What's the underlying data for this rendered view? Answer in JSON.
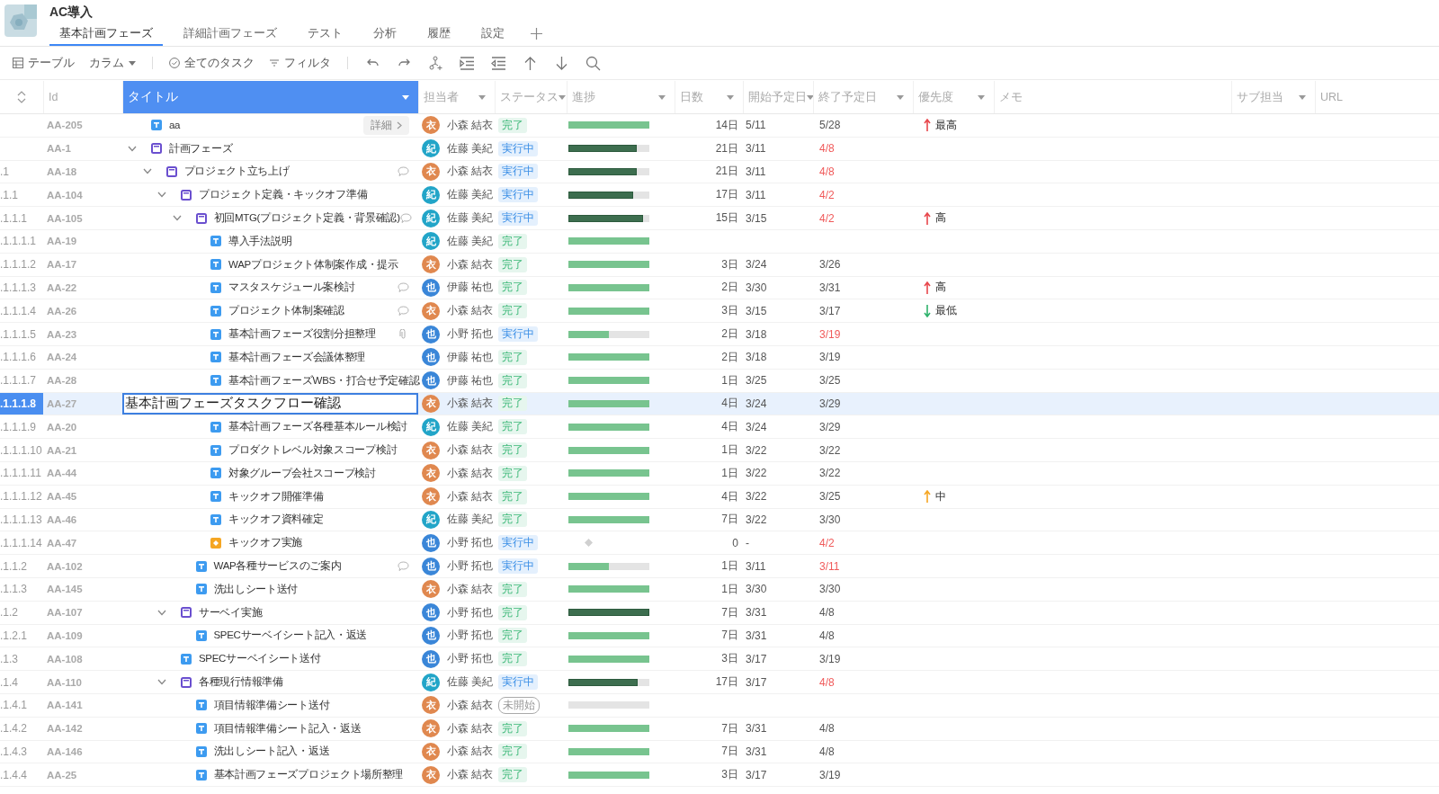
{
  "project": {
    "name": "AC導入"
  },
  "tabs": [
    {
      "label": "基本計画フェーズ",
      "selected": true
    },
    {
      "label": "詳細計画フェーズ",
      "selected": false
    },
    {
      "label": "テスト",
      "selected": false
    },
    {
      "label": "分析",
      "selected": false
    },
    {
      "label": "履歴",
      "selected": false
    },
    {
      "label": "設定",
      "selected": false
    }
  ],
  "toolbar": {
    "view": "テーブル",
    "columns": "カラム",
    "scope": "全てのタスク",
    "filter": "フィルタ"
  },
  "table": {
    "columns": [
      {
        "label": "Id",
        "menu": false,
        "selected": false
      },
      {
        "label": "タイトル",
        "menu": true,
        "selected": true
      },
      {
        "label": "担当者",
        "menu": true,
        "selected": false
      },
      {
        "label": "ステータス",
        "menu": true,
        "selected": false
      },
      {
        "label": "進捗",
        "menu": true,
        "selected": false
      },
      {
        "label": "日数",
        "menu": true,
        "selected": false
      },
      {
        "label": "開始予定日",
        "menu": true,
        "selected": false
      },
      {
        "label": "終了予定日",
        "menu": true,
        "selected": false
      },
      {
        "label": "優先度",
        "menu": true,
        "selected": false
      },
      {
        "label": "メモ",
        "menu": false,
        "selected": false
      },
      {
        "label": "サブ担当",
        "menu": true,
        "selected": false
      },
      {
        "label": "URL",
        "menu": false,
        "selected": false
      }
    ],
    "rows": [
      {
        "id": "AA-205",
        "title": "aa",
        "kind": "task",
        "detail_button": "詳細",
        "selected": false,
        "editing": false,
        "assignee": {
          "initial": "衣",
          "name": "小森 結衣",
          "color": "#e0884f"
        },
        "status": {
          "label": "完了",
          "kind": "done"
        },
        "progress": {
          "kind": "task",
          "level": 1
        },
        "days": "14日",
        "start": "5/11",
        "end": "5/28",
        "overdue": false,
        "priority": {
          "label": "最高",
          "kind": "up",
          "color": "#e8474c"
        }
      },
      {
        "id": "AA-1",
        "title": "計画フェーズ",
        "kind": "folder",
        "expanded": true,
        "selected": false,
        "editing": false,
        "assignee": {
          "initial": "紀",
          "name": "佐藤 美紀",
          "color": "#22a5c8"
        },
        "status": {
          "label": "実行中",
          "kind": "running"
        },
        "progress": {
          "kind": "summary",
          "level": 0.84
        },
        "days": "21日",
        "start": "3/11",
        "end": "4/8",
        "overdue": true,
        "children": [
          {
            "wbs": ".1",
            "id": "AA-18",
            "title": "プロジェクト立ち上げ",
            "kind": "folder",
            "expanded": true,
            "note": {
              "kind": "comment"
            },
            "selected": false,
            "editing": false,
            "assignee": {
              "initial": "衣",
              "name": "小森 結衣",
              "color": "#e0884f"
            },
            "status": {
              "label": "実行中",
              "kind": "running"
            },
            "progress": {
              "kind": "summary",
              "level": 0.84
            },
            "days": "21日",
            "start": "3/11",
            "end": "4/8",
            "overdue": true,
            "children": [
              {
                "wbs": ".1.1",
                "id": "AA-104",
                "title": "プロジェクト定義・キックオフ準備",
                "kind": "folder",
                "expanded": true,
                "selected": false,
                "editing": false,
                "assignee": {
                  "initial": "紀",
                  "name": "佐藤 美紀",
                  "color": "#22a5c8"
                },
                "status": {
                  "label": "実行中",
                  "kind": "running"
                },
                "progress": {
                  "kind": "summary",
                  "level": 0.8
                },
                "days": "17日",
                "start": "3/11",
                "end": "4/2",
                "overdue": true,
                "children": [
                  {
                    "wbs": ".1.1.1",
                    "id": "AA-105",
                    "title": "初回MTG(プロジェクト定義・背景確認)",
                    "kind": "folder",
                    "expanded": true,
                    "note": {
                      "kind": "comment"
                    },
                    "selected": false,
                    "editing": false,
                    "assignee": {
                      "initial": "紀",
                      "name": "佐藤 美紀",
                      "color": "#22a5c8"
                    },
                    "status": {
                      "label": "実行中",
                      "kind": "running"
                    },
                    "progress": {
                      "kind": "summary",
                      "level": 0.92
                    },
                    "days": "15日",
                    "start": "3/15",
                    "end": "4/2",
                    "overdue": true,
                    "priority": {
                      "label": "高",
                      "kind": "up",
                      "color": "#e8474c"
                    },
                    "children": [
                      {
                        "wbs": ".1.1.1.1",
                        "id": "AA-19",
                        "title": "導入手法説明",
                        "kind": "task",
                        "selected": false,
                        "editing": false,
                        "assignee": {
                          "initial": "紀",
                          "name": "佐藤 美紀",
                          "color": "#22a5c8"
                        },
                        "status": {
                          "label": "完了",
                          "kind": "done"
                        },
                        "progress": {
                          "kind": "task",
                          "level": 1
                        },
                        "overdue": false
                      },
                      {
                        "wbs": ".1.1.1.2",
                        "id": "AA-17",
                        "title": "WAPプロジェクト体制案作成・提示",
                        "kind": "task",
                        "selected": false,
                        "editing": false,
                        "assignee": {
                          "initial": "衣",
                          "name": "小森 結衣",
                          "color": "#e0884f"
                        },
                        "status": {
                          "label": "完了",
                          "kind": "done"
                        },
                        "progress": {
                          "kind": "task",
                          "level": 1
                        },
                        "days": "3日",
                        "start": "3/24",
                        "end": "3/26",
                        "overdue": false
                      },
                      {
                        "wbs": ".1.1.1.3",
                        "id": "AA-22",
                        "title": "マスタスケジュール案検討",
                        "kind": "task",
                        "note": {
                          "kind": "comment"
                        },
                        "selected": false,
                        "editing": false,
                        "assignee": {
                          "initial": "也",
                          "name": "伊藤 祐也",
                          "color": "#3a86d8"
                        },
                        "status": {
                          "label": "完了",
                          "kind": "done"
                        },
                        "progress": {
                          "kind": "task",
                          "level": 1
                        },
                        "days": "2日",
                        "start": "3/30",
                        "end": "3/31",
                        "overdue": false,
                        "priority": {
                          "label": "高",
                          "kind": "up",
                          "color": "#e8474c"
                        }
                      },
                      {
                        "wbs": ".1.1.1.4",
                        "id": "AA-26",
                        "title": "プロジェクト体制案確認",
                        "kind": "task",
                        "note": {
                          "kind": "comment"
                        },
                        "selected": false,
                        "editing": false,
                        "assignee": {
                          "initial": "衣",
                          "name": "小森 結衣",
                          "color": "#e0884f"
                        },
                        "status": {
                          "label": "完了",
                          "kind": "done"
                        },
                        "progress": {
                          "kind": "task",
                          "level": 1
                        },
                        "days": "3日",
                        "start": "3/15",
                        "end": "3/17",
                        "overdue": false,
                        "priority": {
                          "label": "最低",
                          "kind": "down",
                          "color": "#2fb26c"
                        }
                      },
                      {
                        "wbs": ".1.1.1.5",
                        "id": "AA-23",
                        "title": "基本計画フェーズ役割分担整理",
                        "kind": "task",
                        "note": {
                          "kind": "attachment"
                        },
                        "selected": false,
                        "editing": false,
                        "assignee": {
                          "initial": "也",
                          "name": "小野 拓也",
                          "color": "#3a86d8"
                        },
                        "status": {
                          "label": "実行中",
                          "kind": "running"
                        },
                        "progress": {
                          "kind": "task",
                          "level": 0.5
                        },
                        "days": "2日",
                        "start": "3/18",
                        "end": "3/19",
                        "overdue": true
                      },
                      {
                        "wbs": ".1.1.1.6",
                        "id": "AA-24",
                        "title": "基本計画フェーズ会議体整理",
                        "kind": "task",
                        "selected": false,
                        "editing": false,
                        "assignee": {
                          "initial": "也",
                          "name": "伊藤 祐也",
                          "color": "#3a86d8"
                        },
                        "status": {
                          "label": "完了",
                          "kind": "done"
                        },
                        "progress": {
                          "kind": "task",
                          "level": 1
                        },
                        "days": "2日",
                        "start": "3/18",
                        "end": "3/19",
                        "overdue": false
                      },
                      {
                        "wbs": ".1.1.1.7",
                        "id": "AA-28",
                        "title": "基本計画フェーズWBS・打合せ予定確認",
                        "kind": "task",
                        "selected": false,
                        "editing": false,
                        "assignee": {
                          "initial": "也",
                          "name": "伊藤 祐也",
                          "color": "#3a86d8"
                        },
                        "status": {
                          "label": "完了",
                          "kind": "done"
                        },
                        "progress": {
                          "kind": "task",
                          "level": 1
                        },
                        "days": "1日",
                        "start": "3/25",
                        "end": "3/25",
                        "overdue": false
                      },
                      {
                        "wbs": ".1.1.1.8",
                        "id": "AA-27",
                        "title": "基本計画フェーズタスクフロー確認",
                        "kind": "task",
                        "selected": true,
                        "editing": true,
                        "assignee": {
                          "initial": "衣",
                          "name": "小森 結衣",
                          "color": "#e0884f"
                        },
                        "status": {
                          "label": "完了",
                          "kind": "done"
                        },
                        "progress": {
                          "kind": "task",
                          "level": 1
                        },
                        "days": "4日",
                        "start": "3/24",
                        "end": "3/29",
                        "overdue": false
                      },
                      {
                        "wbs": ".1.1.1.9",
                        "id": "AA-20",
                        "title": "基本計画フェーズ各種基本ルール検討",
                        "kind": "task",
                        "selected": false,
                        "editing": false,
                        "assignee": {
                          "initial": "紀",
                          "name": "佐藤 美紀",
                          "color": "#22a5c8"
                        },
                        "status": {
                          "label": "完了",
                          "kind": "done"
                        },
                        "progress": {
                          "kind": "task",
                          "level": 1
                        },
                        "days": "4日",
                        "start": "3/24",
                        "end": "3/29",
                        "overdue": false
                      },
                      {
                        "wbs": ".1.1.1.10",
                        "id": "AA-21",
                        "title": "プロダクトレベル対象スコープ検討",
                        "kind": "task",
                        "selected": false,
                        "editing": false,
                        "assignee": {
                          "initial": "衣",
                          "name": "小森 結衣",
                          "color": "#e0884f"
                        },
                        "status": {
                          "label": "完了",
                          "kind": "done"
                        },
                        "progress": {
                          "kind": "task",
                          "level": 1
                        },
                        "days": "1日",
                        "start": "3/22",
                        "end": "3/22",
                        "overdue": false
                      },
                      {
                        "wbs": ".1.1.1.11",
                        "id": "AA-44",
                        "title": "対象グループ会社スコープ検討",
                        "kind": "task",
                        "selected": false,
                        "editing": false,
                        "assignee": {
                          "initial": "衣",
                          "name": "小森 結衣",
                          "color": "#e0884f"
                        },
                        "status": {
                          "label": "完了",
                          "kind": "done"
                        },
                        "progress": {
                          "kind": "task",
                          "level": 1
                        },
                        "days": "1日",
                        "start": "3/22",
                        "end": "3/22",
                        "overdue": false
                      },
                      {
                        "wbs": ".1.1.1.12",
                        "id": "AA-45",
                        "title": "キックオフ開催準備",
                        "kind": "task",
                        "selected": false,
                        "editing": false,
                        "assignee": {
                          "initial": "衣",
                          "name": "小森 結衣",
                          "color": "#e0884f"
                        },
                        "status": {
                          "label": "完了",
                          "kind": "done"
                        },
                        "progress": {
                          "kind": "task",
                          "level": 1
                        },
                        "days": "4日",
                        "start": "3/22",
                        "end": "3/25",
                        "overdue": false,
                        "priority": {
                          "label": "中",
                          "kind": "up",
                          "color": "#f5a623"
                        }
                      },
                      {
                        "wbs": ".1.1.1.13",
                        "id": "AA-46",
                        "title": "キックオフ資料確定",
                        "kind": "task",
                        "selected": false,
                        "editing": false,
                        "assignee": {
                          "initial": "紀",
                          "name": "佐藤 美紀",
                          "color": "#22a5c8"
                        },
                        "status": {
                          "label": "完了",
                          "kind": "done"
                        },
                        "progress": {
                          "kind": "task",
                          "level": 1
                        },
                        "days": "7日",
                        "start": "3/22",
                        "end": "3/30",
                        "overdue": false
                      },
                      {
                        "wbs": ".1.1.1.14",
                        "id": "AA-47",
                        "title": "キックオフ実施",
                        "kind": "milestone",
                        "selected": false,
                        "editing": false,
                        "assignee": {
                          "initial": "也",
                          "name": "小野 拓也",
                          "color": "#3a86d8"
                        },
                        "status": {
                          "label": "実行中",
                          "kind": "running"
                        },
                        "progress": {
                          "kind": "milestone"
                        },
                        "days": "0",
                        "start": "-",
                        "end": "4/2",
                        "overdue": true
                      }
                    ]
                  },
                  {
                    "wbs": ".1.1.2",
                    "id": "AA-102",
                    "title": "WAP各種サービスのご案内",
                    "kind": "task",
                    "note": {
                      "kind": "comment"
                    },
                    "selected": false,
                    "editing": false,
                    "assignee": {
                      "initial": "也",
                      "name": "小野 拓也",
                      "color": "#3a86d8"
                    },
                    "status": {
                      "label": "実行中",
                      "kind": "running"
                    },
                    "progress": {
                      "kind": "task",
                      "level": 0.5
                    },
                    "days": "1日",
                    "start": "3/11",
                    "end": "3/11",
                    "overdue": true
                  },
                  {
                    "wbs": ".1.1.3",
                    "id": "AA-145",
                    "title": "洗出しシート送付",
                    "kind": "task",
                    "selected": false,
                    "editing": false,
                    "assignee": {
                      "initial": "衣",
                      "name": "小森 結衣",
                      "color": "#e0884f"
                    },
                    "status": {
                      "label": "完了",
                      "kind": "done"
                    },
                    "progress": {
                      "kind": "task",
                      "level": 1
                    },
                    "days": "1日",
                    "start": "3/30",
                    "end": "3/30",
                    "overdue": false
                  }
                ]
              },
              {
                "wbs": ".1.2",
                "id": "AA-107",
                "title": "サーベイ実施",
                "kind": "folder",
                "expanded": true,
                "selected": false,
                "editing": false,
                "assignee": {
                  "initial": "也",
                  "name": "小野 拓也",
                  "color": "#3a86d8"
                },
                "status": {
                  "label": "完了",
                  "kind": "done"
                },
                "progress": {
                  "kind": "summary",
                  "level": 1
                },
                "days": "7日",
                "start": "3/31",
                "end": "4/8",
                "overdue": false,
                "children": [
                  {
                    "wbs": ".1.2.1",
                    "id": "AA-109",
                    "title": "SPECサーベイシート記入・返送",
                    "kind": "task",
                    "selected": false,
                    "editing": false,
                    "assignee": {
                      "initial": "也",
                      "name": "小野 拓也",
                      "color": "#3a86d8"
                    },
                    "status": {
                      "label": "完了",
                      "kind": "done"
                    },
                    "progress": {
                      "kind": "task",
                      "level": 1
                    },
                    "days": "7日",
                    "start": "3/31",
                    "end": "4/8",
                    "overdue": false
                  }
                ]
              },
              {
                "wbs": ".1.3",
                "id": "AA-108",
                "title": "SPECサーベイシート送付",
                "kind": "task",
                "selected": false,
                "editing": false,
                "assignee": {
                  "initial": "也",
                  "name": "小野 拓也",
                  "color": "#3a86d8"
                },
                "status": {
                  "label": "完了",
                  "kind": "done"
                },
                "progress": {
                  "kind": "task",
                  "level": 1
                },
                "days": "3日",
                "start": "3/17",
                "end": "3/19",
                "overdue": false
              },
              {
                "wbs": ".1.4",
                "id": "AA-110",
                "title": "各種現行情報準備",
                "kind": "folder",
                "expanded": true,
                "selected": false,
                "editing": false,
                "assignee": {
                  "initial": "紀",
                  "name": "佐藤 美紀",
                  "color": "#22a5c8"
                },
                "status": {
                  "label": "実行中",
                  "kind": "running"
                },
                "progress": {
                  "kind": "summary",
                  "level": 0.86
                },
                "days": "17日",
                "start": "3/17",
                "end": "4/8",
                "overdue": true,
                "children": [
                  {
                    "wbs": ".1.4.1",
                    "id": "AA-141",
                    "title": "項目情報準備シート送付",
                    "kind": "task",
                    "selected": false,
                    "editing": false,
                    "assignee": {
                      "initial": "衣",
                      "name": "小森 結衣",
                      "color": "#e0884f"
                    },
                    "status": {
                      "label": "未開始",
                      "kind": "not_started"
                    },
                    "progress": {
                      "kind": "task",
                      "level": 0
                    },
                    "overdue": false
                  },
                  {
                    "wbs": ".1.4.2",
                    "id": "AA-142",
                    "title": "項目情報準備シート記入・返送",
                    "kind": "task",
                    "selected": false,
                    "editing": false,
                    "assignee": {
                      "initial": "衣",
                      "name": "小森 結衣",
                      "color": "#e0884f"
                    },
                    "status": {
                      "label": "完了",
                      "kind": "done"
                    },
                    "progress": {
                      "kind": "task",
                      "level": 1
                    },
                    "days": "7日",
                    "start": "3/31",
                    "end": "4/8",
                    "overdue": false
                  },
                  {
                    "wbs": ".1.4.3",
                    "id": "AA-146",
                    "title": "洗出しシート記入・返送",
                    "kind": "task",
                    "selected": false,
                    "editing": false,
                    "assignee": {
                      "initial": "衣",
                      "name": "小森 結衣",
                      "color": "#e0884f"
                    },
                    "status": {
                      "label": "完了",
                      "kind": "done"
                    },
                    "progress": {
                      "kind": "task",
                      "level": 1
                    },
                    "days": "7日",
                    "start": "3/31",
                    "end": "4/8",
                    "overdue": false
                  },
                  {
                    "wbs": ".1.4.4",
                    "id": "AA-25",
                    "title": "基本計画フェーズプロジェクト場所整理",
                    "kind": "task",
                    "selected": false,
                    "editing": false,
                    "assignee": {
                      "initial": "衣",
                      "name": "小森 結衣",
                      "color": "#e0884f"
                    },
                    "status": {
                      "label": "完了",
                      "kind": "done"
                    },
                    "progress": {
                      "kind": "task",
                      "level": 1
                    },
                    "days": "3日",
                    "start": "3/17",
                    "end": "3/19",
                    "overdue": false
                  }
                ]
              }
            ]
          }
        ]
      }
    ]
  }
}
